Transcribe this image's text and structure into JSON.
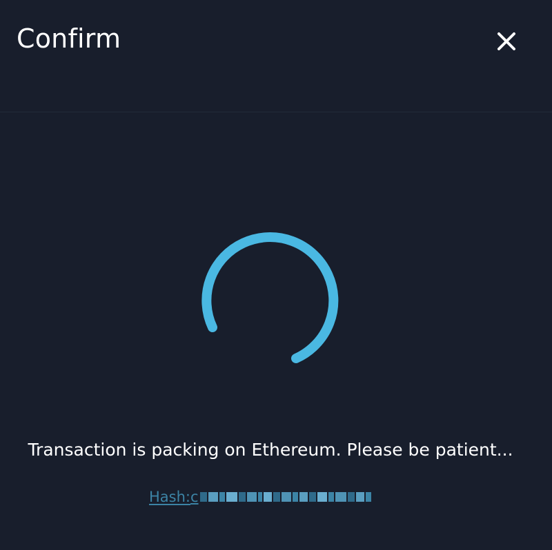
{
  "header": {
    "title": "Confirm",
    "close_icon": "close-icon"
  },
  "status": {
    "spinner_icon": "loading-spinner-icon",
    "message": "Transaction is packing on Ethereum. Please be patient...",
    "hash_label": "Hash: ",
    "hash_value": "c"
  },
  "colors": {
    "background": "#181e2c",
    "accent": "#4ab8e2",
    "link": "#3c84a6",
    "text": "#ffffff"
  }
}
